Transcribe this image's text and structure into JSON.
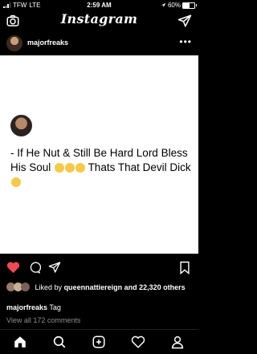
{
  "status_bar": {
    "carrier": "TFW",
    "network": "LTE",
    "time": "2:59 AM",
    "battery": "60%",
    "battery_level": 0.6
  },
  "header": {
    "title": "Instagram"
  },
  "post": {
    "username": "majorfreaks",
    "text": "- If He Nut & Still Be Hard Lord Bless His Soul",
    "text_tail": "Thats That Devil Dick",
    "liked_by_prefix": "Liked by",
    "liked_by_user": "queennattiereign",
    "liked_by_rest": "and 22,320 others",
    "caption_user": "majorfreaks",
    "caption_text": "Tag",
    "view_comments": "View all 172 comments"
  },
  "colors": {
    "like": "#ed4956",
    "muted": "#8e8e8e"
  }
}
